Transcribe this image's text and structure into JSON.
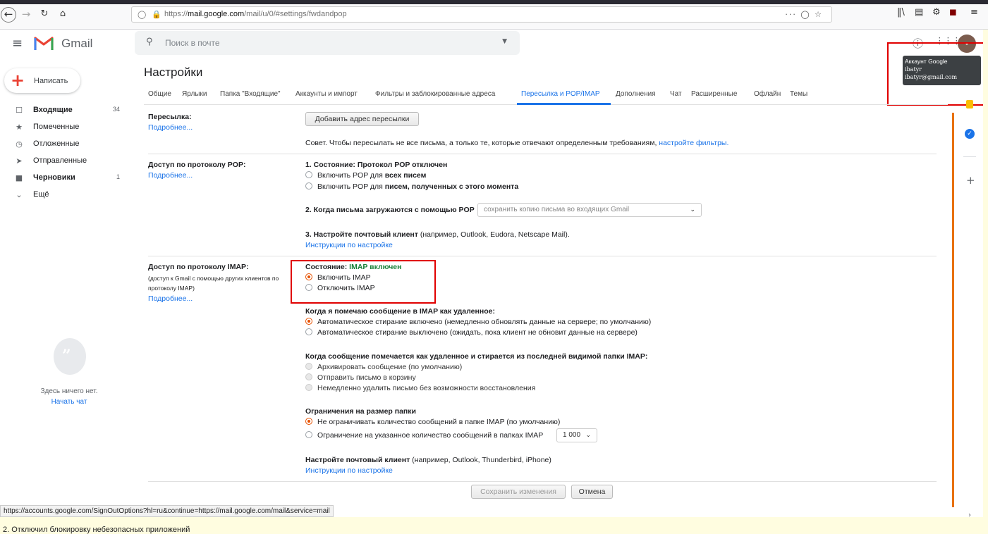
{
  "browser": {
    "url_prefix": "https://",
    "url_host": "mail.google.com",
    "url_path": "/mail/u/0/#settings/fwdandpop",
    "more": "···"
  },
  "header": {
    "brand": "Gmail",
    "search_placeholder": "Поиск в почте",
    "avatar_letter": "•"
  },
  "tooltip": {
    "title": "Аккаунт Google",
    "name": "ibatyr",
    "email": "ibatyr@gmail.com"
  },
  "sidebar": {
    "compose": "Написать",
    "items": [
      {
        "label": "Входящие",
        "count": "34",
        "bold": true,
        "icon": "inbox-icon"
      },
      {
        "label": "Помеченные",
        "count": "",
        "bold": false,
        "icon": "star-icon"
      },
      {
        "label": "Отложенные",
        "count": "",
        "bold": false,
        "icon": "clock-icon"
      },
      {
        "label": "Отправленные",
        "count": "",
        "bold": false,
        "icon": "send-icon"
      },
      {
        "label": "Черновики",
        "count": "1",
        "bold": true,
        "icon": "draft-icon"
      },
      {
        "label": "Ещё",
        "count": "",
        "bold": false,
        "icon": "chevron-down-icon"
      }
    ],
    "chat_empty": "Здесь ничего нет.",
    "chat_start": "Начать чат"
  },
  "settings": {
    "title": "Настройки",
    "tabs": [
      "Общие",
      "Ярлыки",
      "Папка \"Входящие\"",
      "Аккаунты и импорт",
      "Фильтры и заблокированные адреса",
      "Пересылка и POP/IMAP",
      "Дополнения",
      "Чат",
      "Расширенные",
      "Офлайн",
      "Темы"
    ],
    "active_tab": "Пересылка и POP/IMAP",
    "more_link": "Подробнее...",
    "forwarding": {
      "title": "Пересылка:",
      "add_button": "Добавить адрес пересылки",
      "tip": "Совет. Чтобы пересылать не все письма, а только те, которые отвечают определенным требованиям,",
      "tip_link": "настройте фильтры."
    },
    "pop": {
      "title": "Доступ по протоколу POP:",
      "status": "1. Состояние: Протокол POP отключен",
      "opt1_prefix": "Включить POP для ",
      "opt1_bold": "всех писем",
      "opt2_prefix": "Включить POP для ",
      "opt2_bold": "писем, полученных с этого момента",
      "when_label": "2. Когда письма загружаются с помощью POP",
      "when_value": "сохранить копию письма во входящих Gmail",
      "client_bold": "3. Настройте почтовый клиент",
      "client_rest": " (например, Outlook, Eudora, Netscape Mail).",
      "instr": "Инструкции по настройке"
    },
    "imap": {
      "title": "Доступ по протоколу IMAP:",
      "desc1": "(доступ к Gmail с помощью других клиентов по",
      "desc2": "протоколу IMAP)",
      "status_label": "Состояние: ",
      "status_value": "IMAP включен",
      "enable": "Включить IMAP",
      "disable": "Отключить IMAP",
      "delete_title": "Когда я помечаю сообщение в IMAP как удаленное:",
      "delete_opt1": "Автоматическое стирание включено (немедленно обновлять данные на сервере; по умолчанию)",
      "delete_opt2": "Автоматическое стирание выключено (ожидать, пока клиент не обновит данные на сервере)",
      "expunge_title": "Когда сообщение помечается как удаленное и стирается из последней видимой папки IMAP:",
      "expunge_opt1": "Архивировать сообщение (по умолчанию)",
      "expunge_opt2": "Отправить письмо в корзину",
      "expunge_opt3": "Немедленно удалить письмо без возможности восстановления",
      "size_title": "Ограничения на размер папки",
      "size_opt1": "Не ограничивать количество сообщений в папке IMAP (по умолчанию)",
      "size_opt2": "Ограничение на указанное количество сообщений в папках IMAP",
      "size_value": "1 000",
      "client_bold": "Настройте почтовый клиент",
      "client_rest": " (например, Outlook, Thunderbird, iPhone)",
      "instr": "Инструкции по настройке"
    },
    "save": "Сохранить изменения",
    "cancel": "Отмена"
  },
  "status_url": "https://accounts.google.com/SignOutOptions?hl=ru&continue=https://mail.google.com/mail&service=mail",
  "caption": "2. Отключил блокировку небезопасных приложений",
  "colors": {
    "accent": "#1a73e8",
    "radio_on": "#e65100",
    "highlight": "#e00000",
    "status_on": "#188038"
  }
}
